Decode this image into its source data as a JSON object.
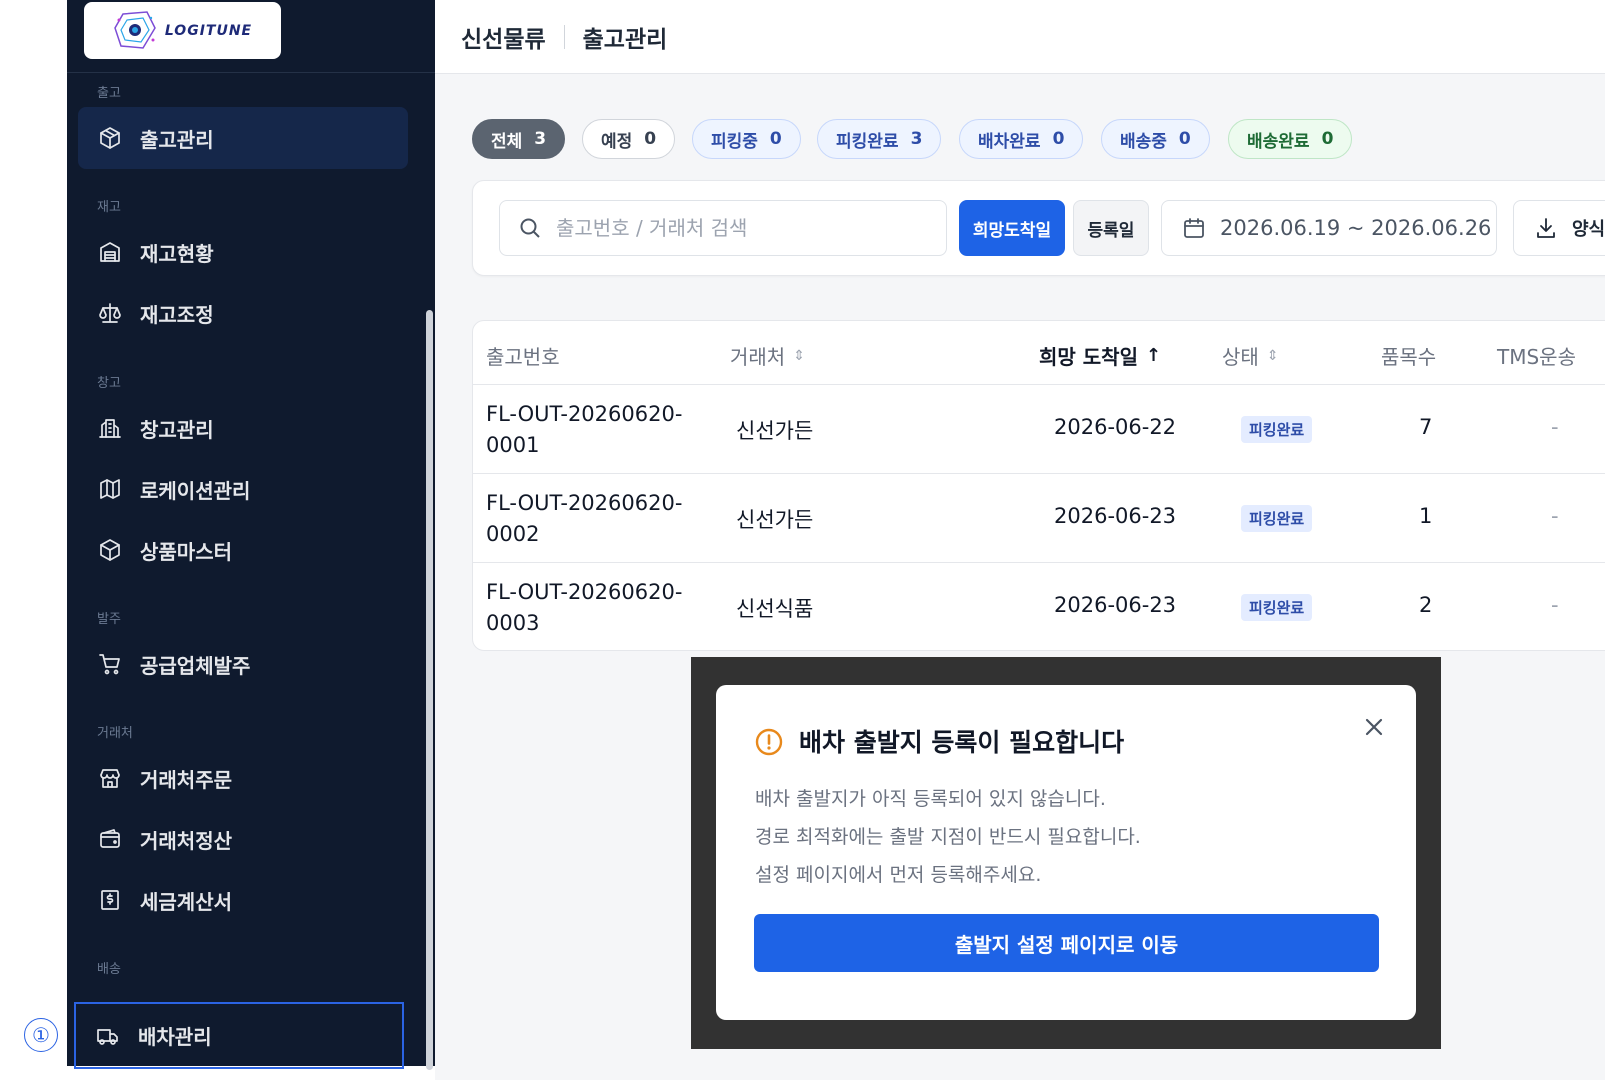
{
  "brand": {
    "logo_text": "LOGITUNE"
  },
  "sidebar": {
    "sections": [
      {
        "label": "출고",
        "items": [
          {
            "label": "출고관리",
            "icon": "package-icon"
          }
        ]
      },
      {
        "label": "재고",
        "items": [
          {
            "label": "재고현황",
            "icon": "warehouse-icon"
          },
          {
            "label": "재고조정",
            "icon": "scale-icon"
          }
        ]
      },
      {
        "label": "창고",
        "items": [
          {
            "label": "창고관리",
            "icon": "building-icon"
          },
          {
            "label": "로케이션관리",
            "icon": "map-icon"
          },
          {
            "label": "상품마스터",
            "icon": "box-icon"
          }
        ]
      },
      {
        "label": "발주",
        "items": [
          {
            "label": "공급업체발주",
            "icon": "cart-icon"
          }
        ]
      },
      {
        "label": "거래처",
        "items": [
          {
            "label": "거래처주문",
            "icon": "store-icon"
          },
          {
            "label": "거래처정산",
            "icon": "wallet-icon"
          },
          {
            "label": "세금계산서",
            "icon": "invoice-icon"
          }
        ]
      },
      {
        "label": "배송",
        "items": [
          {
            "label": "배차관리",
            "icon": "truck-icon"
          }
        ]
      }
    ]
  },
  "annotation": {
    "marker": "①"
  },
  "header": {
    "breadcrumb": [
      "신선물류",
      "출고관리"
    ]
  },
  "status_chips": [
    {
      "label": "전체",
      "count": "3"
    },
    {
      "label": "예정",
      "count": "0"
    },
    {
      "label": "피킹중",
      "count": "0"
    },
    {
      "label": "피킹완료",
      "count": "3"
    },
    {
      "label": "배차완료",
      "count": "0"
    },
    {
      "label": "배송중",
      "count": "0"
    },
    {
      "label": "배송완료",
      "count": "0"
    }
  ],
  "filters": {
    "search_placeholder": "출고번호 / 거래처 검색",
    "date_type_primary": "희망도착일",
    "date_type_secondary": "등록일",
    "date_range": "2026.06.19 ~ 2026.06.26",
    "export_label": "양식"
  },
  "table": {
    "columns": [
      "출고번호",
      "거래처",
      "희망 도착일",
      "상태",
      "품목수",
      "TMS운송"
    ],
    "rows": [
      {
        "id": "FL-OUT-20260620-0001",
        "partner": "신선가든",
        "date": "2026-06-22",
        "status": "피킹완료",
        "qty": "7",
        "tms": "-"
      },
      {
        "id": "FL-OUT-20260620-0002",
        "partner": "신선가든",
        "date": "2026-06-23",
        "status": "피킹완료",
        "qty": "1",
        "tms": "-"
      },
      {
        "id": "FL-OUT-20260620-0003",
        "partner": "신선식품",
        "date": "2026-06-23",
        "status": "피킹완료",
        "qty": "2",
        "tms": "-"
      }
    ]
  },
  "modal": {
    "title": "배차 출발지 등록이 필요합니다",
    "lines": [
      "배차 출발지가 아직 등록되어 있지 않습니다.",
      "경로 최적화에는 출발 지점이 반드시 필요합니다.",
      "설정 페이지에서 먼저 등록해주세요."
    ],
    "button_label": "출발지 설정 페이지로 이동"
  },
  "colors": {
    "sidebar_bg": "#0f1a2e",
    "primary": "#1e63e6",
    "warning": "#e8891c"
  }
}
